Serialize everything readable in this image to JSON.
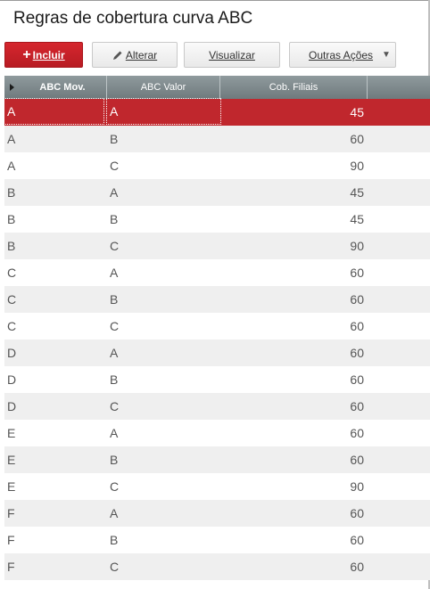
{
  "page": {
    "title": "Regras de cobertura curva ABC"
  },
  "toolbar": {
    "incluir": "Incluir",
    "alterar": "Alterar",
    "visualizar": "Visualizar",
    "outras": "Outras Ações"
  },
  "grid": {
    "headers": [
      "ABC Mov.",
      "ABC Valor",
      "Cob. Filiais"
    ],
    "rows": [
      {
        "abc_mov": "A",
        "abc_valor": "A",
        "cob": "45",
        "selected": true
      },
      {
        "abc_mov": "A",
        "abc_valor": "B",
        "cob": "60"
      },
      {
        "abc_mov": "A",
        "abc_valor": "C",
        "cob": "90"
      },
      {
        "abc_mov": "B",
        "abc_valor": "A",
        "cob": "45"
      },
      {
        "abc_mov": "B",
        "abc_valor": "B",
        "cob": "45"
      },
      {
        "abc_mov": "B",
        "abc_valor": "C",
        "cob": "90"
      },
      {
        "abc_mov": "C",
        "abc_valor": "A",
        "cob": "60"
      },
      {
        "abc_mov": "C",
        "abc_valor": "B",
        "cob": "60"
      },
      {
        "abc_mov": "C",
        "abc_valor": "C",
        "cob": "60"
      },
      {
        "abc_mov": "D",
        "abc_valor": "A",
        "cob": "60"
      },
      {
        "abc_mov": "D",
        "abc_valor": "B",
        "cob": "60"
      },
      {
        "abc_mov": "D",
        "abc_valor": "C",
        "cob": "60"
      },
      {
        "abc_mov": "E",
        "abc_valor": "A",
        "cob": "60"
      },
      {
        "abc_mov": "E",
        "abc_valor": "B",
        "cob": "60"
      },
      {
        "abc_mov": "E",
        "abc_valor": "C",
        "cob": "90"
      },
      {
        "abc_mov": "F",
        "abc_valor": "A",
        "cob": "60"
      },
      {
        "abc_mov": "F",
        "abc_valor": "B",
        "cob": "60"
      },
      {
        "abc_mov": "F",
        "abc_valor": "C",
        "cob": "60"
      }
    ]
  },
  "colors": {
    "accent": "#c0272d",
    "header": "#7a8588",
    "row_alt": "#efefef"
  },
  "icons": {
    "incluir": "plus-icon",
    "alterar": "pencil-icon",
    "outras": "caret-down-icon",
    "grid": "row-indicator-icon"
  }
}
